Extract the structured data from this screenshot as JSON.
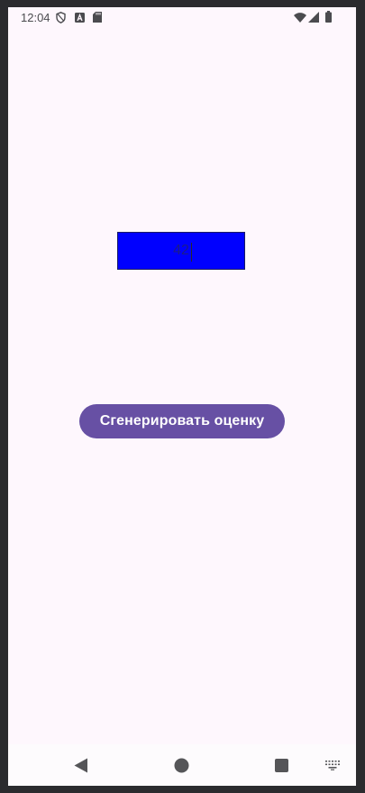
{
  "status_bar": {
    "time": "12:04",
    "left_icons": [
      "shield-icon",
      "a-badge-icon",
      "sd-card-icon"
    ],
    "right_icons": [
      "wifi-icon",
      "cellular-signal-icon",
      "battery-icon"
    ]
  },
  "main": {
    "value": "42",
    "generate_button_label": "Сгенерировать оценку"
  },
  "navigation_bar": {
    "items": [
      "back-icon",
      "home-icon",
      "recents-icon",
      "keyboard-icon"
    ]
  },
  "colors": {
    "background": "#fef7fd",
    "value_box": "#0000ff",
    "button": "#6750a4",
    "button_text": "#ffffff"
  }
}
